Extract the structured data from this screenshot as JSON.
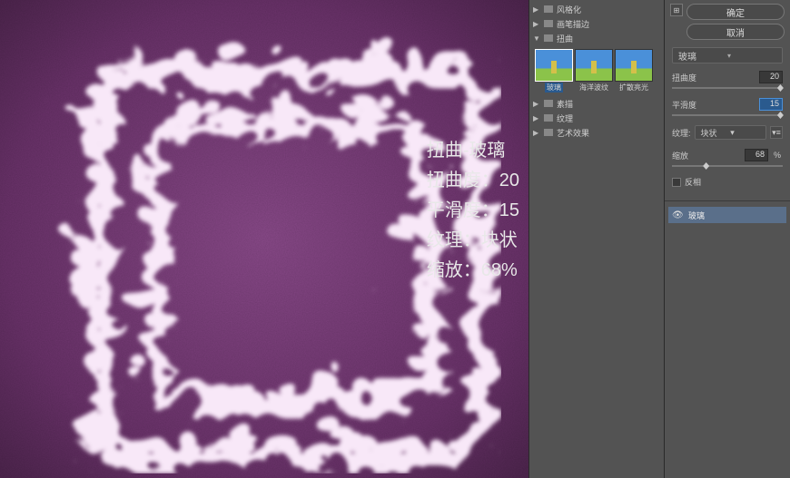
{
  "buttons": {
    "ok": "确定",
    "cancel": "取消"
  },
  "filterTree": {
    "categories": {
      "stylize": "风格化",
      "brush": "画笔描边",
      "distort": "扭曲",
      "sketch": "素描",
      "texture": "纹理",
      "artistic": "艺术效果"
    },
    "distortThumbs": {
      "glass": "玻璃",
      "ocean": "海洋波纹",
      "diffuse": "扩散亮光"
    }
  },
  "currentFilter": "玻璃",
  "params": {
    "distortion": {
      "label": "扭曲度",
      "value": "20"
    },
    "smoothness": {
      "label": "平滑度",
      "value": "15"
    },
    "texture": {
      "label": "纹理:",
      "value": "块状"
    },
    "scale": {
      "label": "缩放",
      "value": "68",
      "unit": "%"
    },
    "invert": {
      "label": "反相"
    }
  },
  "layers": {
    "glass": "玻璃"
  },
  "overlay": {
    "title": "扭曲-玻璃",
    "l1": "扭曲度：20",
    "l2": "平滑度：15",
    "l3": "纹理：块状",
    "l4": "缩放：68%"
  }
}
